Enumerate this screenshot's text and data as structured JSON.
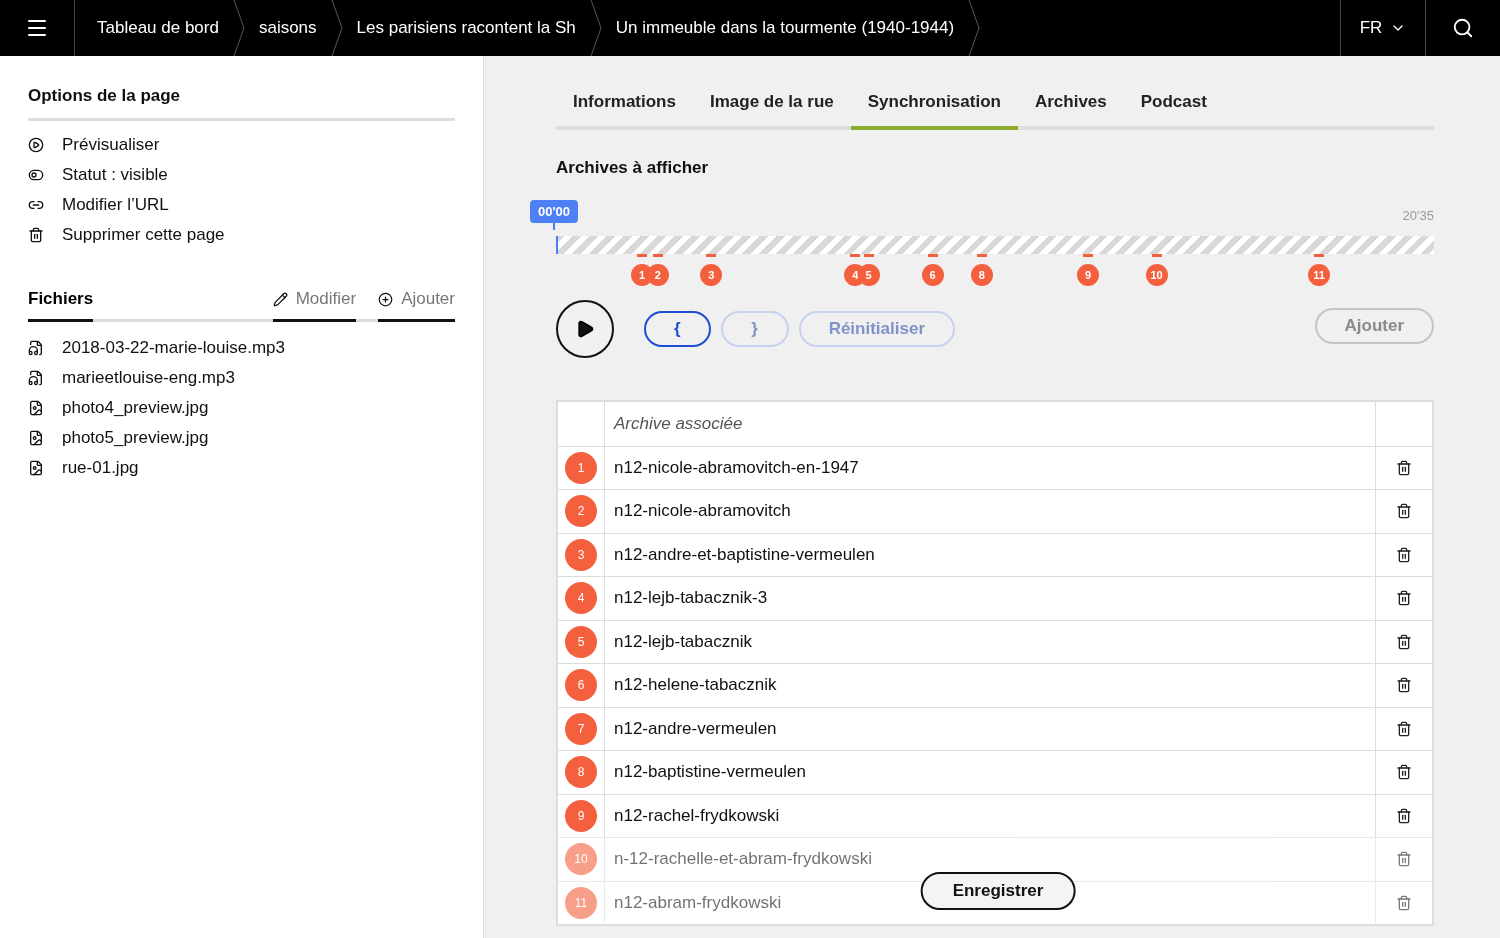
{
  "breadcrumbs": [
    "Tableau de bord",
    "saisons",
    "Les parisiens racontent la Sh",
    "Un immeuble dans la tourmente (1940-1944)"
  ],
  "language": "FR",
  "sidebar": {
    "title": "Options de la page",
    "options": [
      {
        "kind": "preview",
        "label": "Prévisualiser"
      },
      {
        "kind": "toggle",
        "label": "Statut : visible"
      },
      {
        "kind": "link",
        "label": "Modifier l’URL"
      },
      {
        "kind": "delete",
        "label": "Supprimer cette page"
      }
    ],
    "files_title": "Fichiers",
    "files_actions": [
      {
        "kind": "edit",
        "label": "Modifier"
      },
      {
        "kind": "add",
        "label": "Ajouter"
      }
    ],
    "files": [
      {
        "kind": "audio",
        "name": "2018-03-22-marie-louise.mp3"
      },
      {
        "kind": "audio",
        "name": "marieetlouise-eng.mp3"
      },
      {
        "kind": "image",
        "name": "photo4_preview.jpg"
      },
      {
        "kind": "image",
        "name": "photo5_preview.jpg"
      },
      {
        "kind": "image",
        "name": "rue-01.jpg"
      }
    ]
  },
  "tabs": [
    {
      "label": "Informations",
      "selected": false
    },
    {
      "label": "Image de la rue",
      "selected": false
    },
    {
      "label": "Synchronisation",
      "selected": true
    },
    {
      "label": "Archives",
      "selected": false
    },
    {
      "label": "Podcast",
      "selected": false
    }
  ],
  "section_title": "Archives à afficher",
  "timeline": {
    "current": "00'00",
    "duration": "20'35",
    "level": 0,
    "markers": [
      {
        "label": "1",
        "level": 0.098
      },
      {
        "label": "2",
        "level": 0.116
      },
      {
        "label": "3",
        "level": 0.177
      },
      {
        "label": "4",
        "level": 0.341
      },
      {
        "label": "5",
        "level": 0.356
      },
      {
        "label": "6",
        "level": 0.429
      },
      {
        "label": "8",
        "level": 0.485
      },
      {
        "label": "9",
        "level": 0.606
      },
      {
        "label": "10",
        "level": 0.684
      },
      {
        "label": "11",
        "level": 0.869
      }
    ]
  },
  "controls": [
    {
      "kind": "start",
      "label": "{",
      "disabled": false
    },
    {
      "kind": "end",
      "label": "}",
      "disabled": true
    },
    {
      "kind": "reset",
      "label": "Réinitialiser",
      "disabled": true
    }
  ],
  "add_button": {
    "label": "Ajouter",
    "disabled": true
  },
  "table": {
    "column": "Archive associée",
    "rows": [
      {
        "number": "1",
        "name": "n12-nicole-abramovitch-en-1947",
        "faded": false
      },
      {
        "number": "2",
        "name": "n12-nicole-abramovitch",
        "faded": false
      },
      {
        "number": "3",
        "name": "n12-andre-et-baptistine-vermeulen",
        "faded": false
      },
      {
        "number": "4",
        "name": "n12-lejb-tabacznik-3",
        "faded": false
      },
      {
        "number": "5",
        "name": "n12-lejb-tabacznik",
        "faded": false
      },
      {
        "number": "6",
        "name": "n12-helene-tabacznik",
        "faded": false
      },
      {
        "number": "7",
        "name": "n12-andre-vermeulen",
        "faded": false
      },
      {
        "number": "8",
        "name": "n12-baptistine-vermeulen",
        "faded": false
      },
      {
        "number": "9",
        "name": "n12-rachel-frydkowski",
        "faded": false
      },
      {
        "number": "10",
        "name": "n-12-rachelle-et-abram-frydkowski",
        "faded": true
      },
      {
        "number": "11",
        "name": "n12-abram-frydkowski",
        "faded": true
      }
    ]
  },
  "save_button": "Enregistrer"
}
